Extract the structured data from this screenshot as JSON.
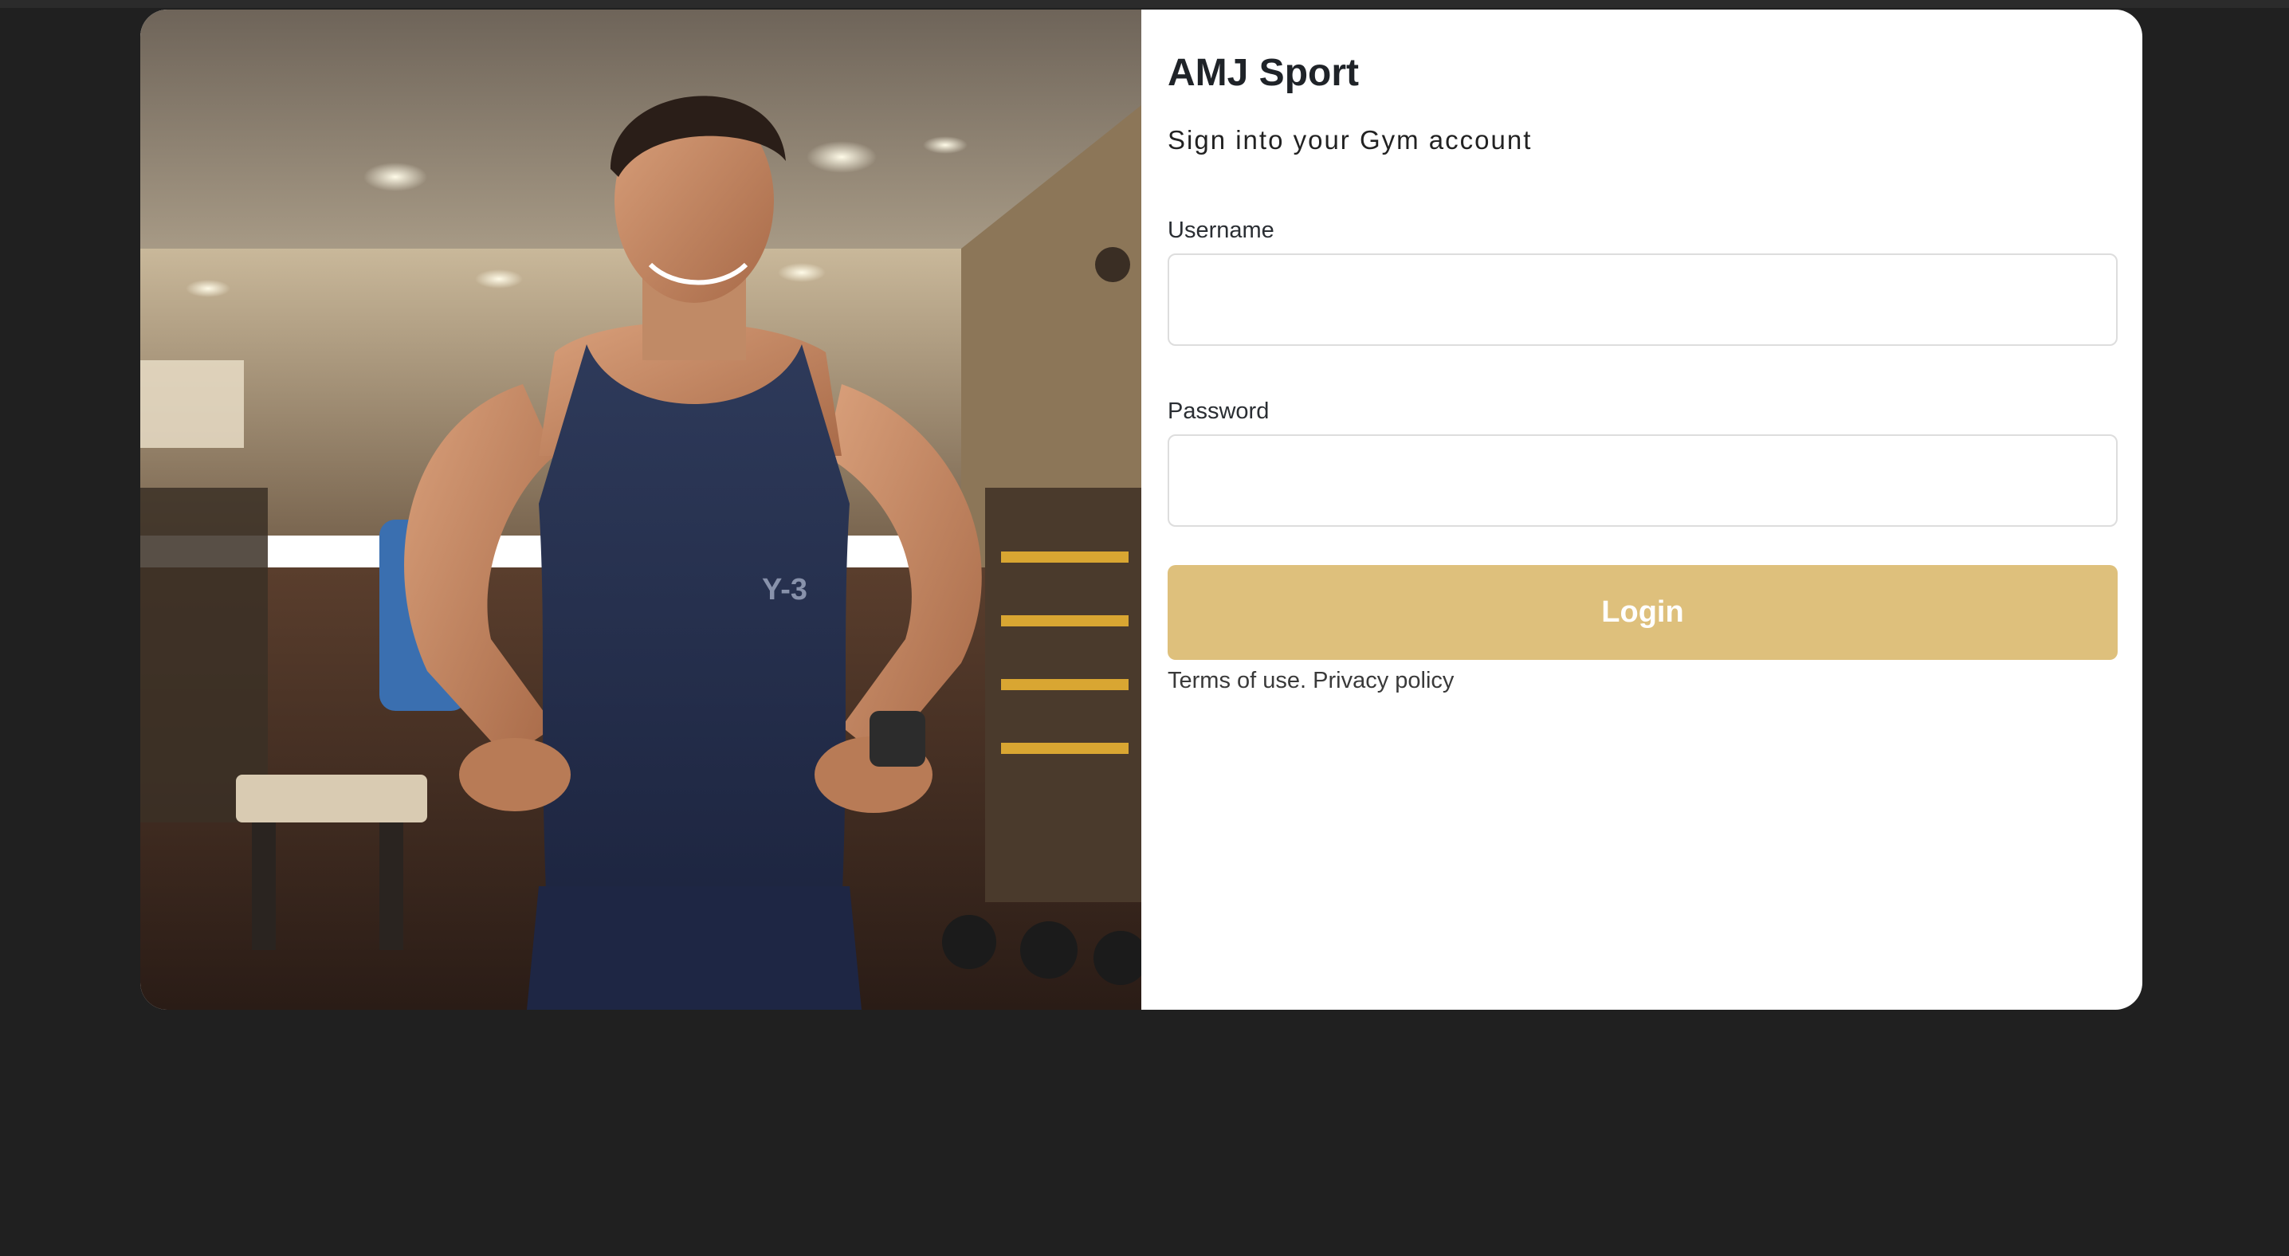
{
  "brand": "AMJ Sport",
  "subtitle": "Sign into your Gym account",
  "form": {
    "username_label": "Username",
    "username_value": "",
    "password_label": "Password",
    "password_value": "",
    "login_label": "Login"
  },
  "legal": {
    "terms": "Terms of use.",
    "privacy": "Privacy policy"
  },
  "colors": {
    "page_background": "#202020",
    "button": "#dec07c",
    "card": "#ffffff"
  }
}
